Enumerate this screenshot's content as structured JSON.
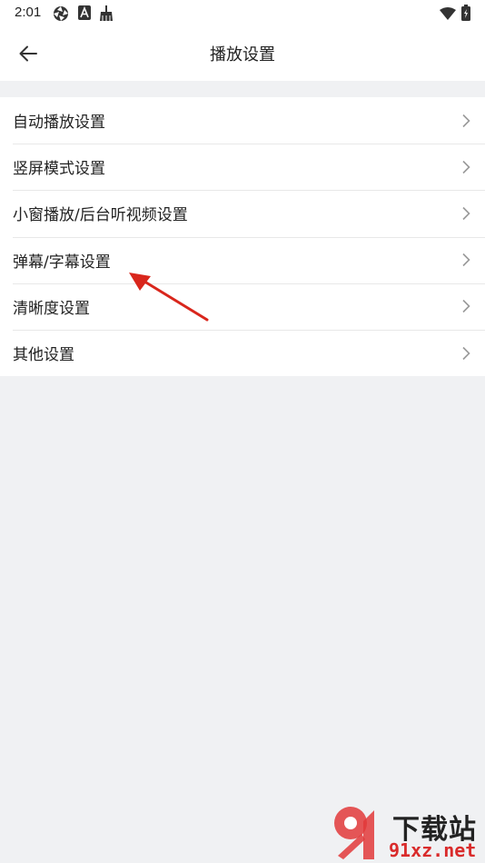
{
  "status_bar": {
    "time": "2:01",
    "left_icons": [
      "aperture-icon",
      "a-badge-icon",
      "broom-icon"
    ],
    "right_icons": [
      "wifi-icon",
      "battery-icon"
    ]
  },
  "header": {
    "title": "播放设置",
    "back_icon": "back-arrow-icon"
  },
  "settings": {
    "items": [
      {
        "label": "自动播放设置"
      },
      {
        "label": "竖屏模式设置"
      },
      {
        "label": "小窗播放/后台听视频设置"
      },
      {
        "label": "弹幕/字幕设置"
      },
      {
        "label": "清晰度设置"
      },
      {
        "label": "其他设置"
      }
    ]
  },
  "watermark": {
    "line1": "下载站",
    "line2": "91xz.net"
  },
  "colors": {
    "background": "#f0f1f3",
    "surface": "#ffffff",
    "text": "#222222",
    "chevron": "#9a9a9a",
    "annotation": "#d9261c"
  }
}
